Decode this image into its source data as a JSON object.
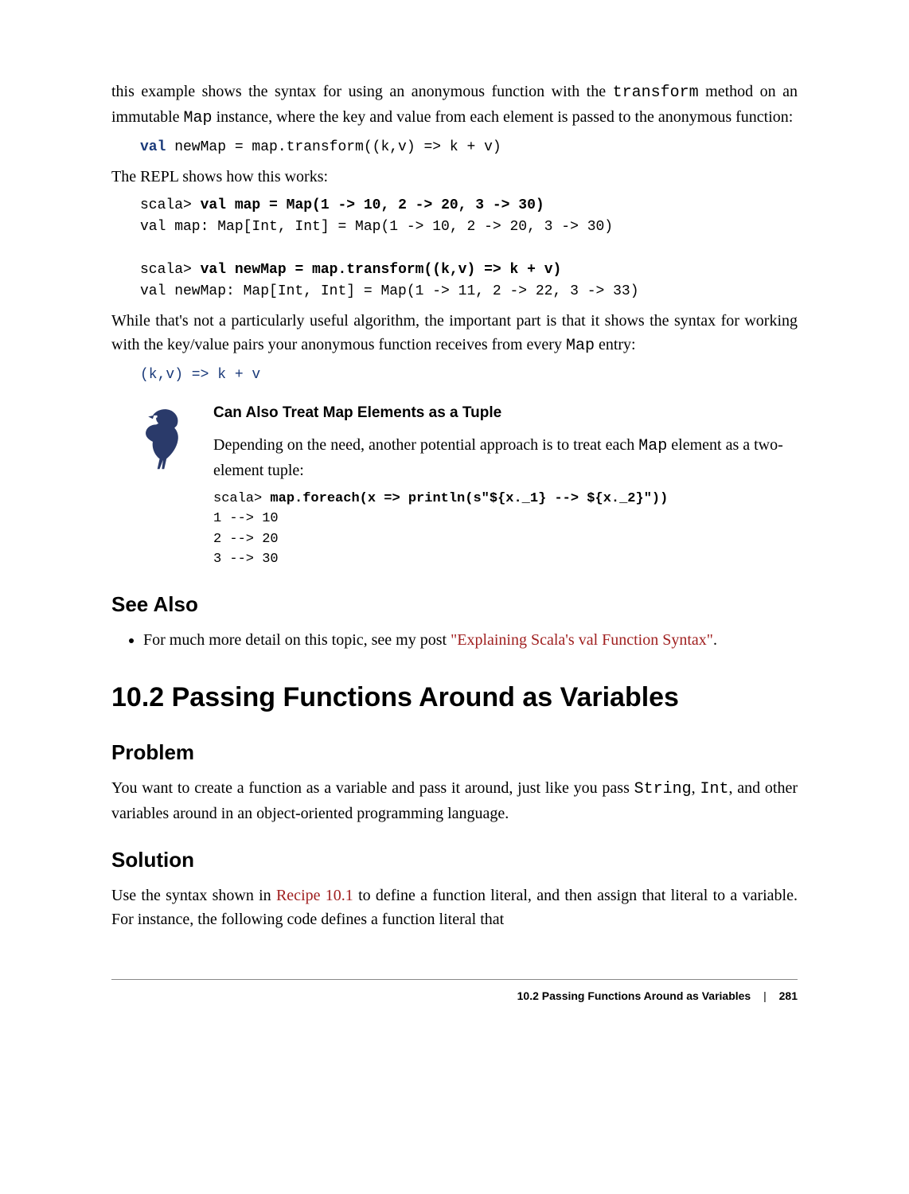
{
  "para1_pre": "this example shows the syntax for using an anonymous function with the ",
  "para1_code": "transform",
  "para1_mid": " method on an immutable ",
  "para1_code2": "Map",
  "para1_post": " instance, where the key and value from each element is passed to the anonymous function:",
  "code1": {
    "val": "val",
    "rest": " newMap = map.transform((k,v) => k + v)"
  },
  "para2": "The REPL shows how this works:",
  "repl1_l1a": "scala> ",
  "repl1_l1b": "val map = Map(1 -> 10, 2 -> 20, 3 -> 30)",
  "repl1_l2": "val map: Map[Int, Int] = Map(1 -> 10, 2 -> 20, 3 -> 30)",
  "repl1_l3a": "scala> ",
  "repl1_l3b": "val newMap = map.transform((k,v) => k + v)",
  "repl1_l4": "val newMap: Map[Int, Int] = Map(1 -> 11, 2 -> 22, 3 -> 33)",
  "para3_pre": "While that's not a particularly useful algorithm, the important part is that it shows the syntax for working with the key/value pairs your anonymous function receives from every ",
  "para3_code": "Map",
  "para3_post": " entry:",
  "short_code": "(k,v) => k + v",
  "note": {
    "title": "Can Also Treat Map Elements as a Tuple",
    "para_pre": "Depending on the need, another potential approach is to treat each ",
    "para_code": "Map",
    "para_post": " element as a two-element tuple:",
    "code_l1a": "scala> ",
    "code_l1b": "map.foreach(x => println(s\"${x._1} --> ${x._2}\"))",
    "code_l2": "1 --> 10",
    "code_l3": "2 --> 20",
    "code_l4": "3 --> 30"
  },
  "see_also_heading": "See Also",
  "see_also_item_pre": "For much more detail on this topic, see my post ",
  "see_also_link": "\"Explaining Scala's val Function Syntax\"",
  "see_also_item_post": ".",
  "section_title": "10.2 Passing Functions Around as Variables",
  "problem_heading": "Problem",
  "problem_para_pre": "You want to create a function as a variable and pass it around, just like you pass ",
  "problem_code1": "String",
  "problem_mid1": ", ",
  "problem_code2": "Int",
  "problem_mid2": ", and other variables around in an object-oriented programming language.",
  "solution_heading": "Solution",
  "solution_para_pre": "Use the syntax shown in ",
  "solution_link": "Recipe 10.1",
  "solution_para_post": " to define a function literal, and then assign that literal to a variable. For instance, the following code defines a function literal that",
  "footer_section": "10.2 Passing Functions Around as Variables",
  "footer_sep": "|",
  "footer_page": "281"
}
